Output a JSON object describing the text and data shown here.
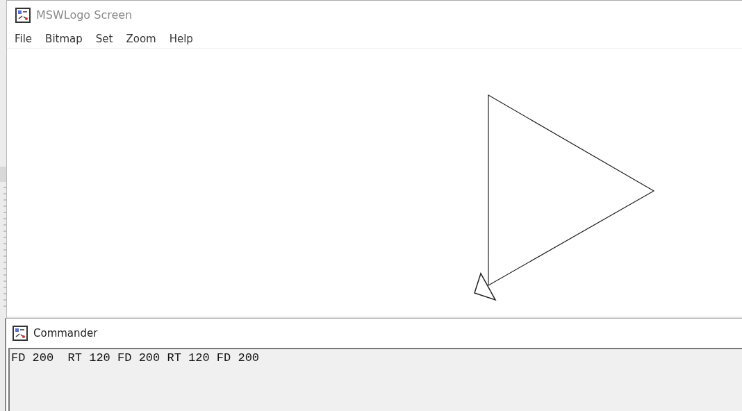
{
  "window": {
    "title": "MSWLogo Screen"
  },
  "menu": [
    {
      "label": "File"
    },
    {
      "label": "Bitmap"
    },
    {
      "label": "Set"
    },
    {
      "label": "Zoom"
    },
    {
      "label": "Help"
    }
  ],
  "commander": {
    "title": "Commander",
    "input": "FD 200  RT 120 FD 200 RT 120 FD 200"
  }
}
